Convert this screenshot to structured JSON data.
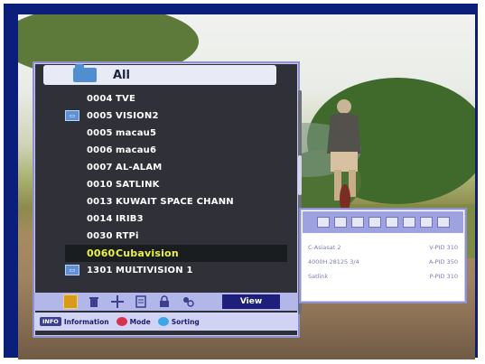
{
  "channel_list": {
    "group_name": "All",
    "channels": [
      {
        "number": "0004",
        "name": "TVE",
        "icon": ""
      },
      {
        "number": "0005",
        "name": "VISION2",
        "icon": "tv-channel-icon"
      },
      {
        "number": "0005",
        "name": "macau5",
        "icon": ""
      },
      {
        "number": "0006",
        "name": "macau6",
        "icon": ""
      },
      {
        "number": "0007",
        "name": "AL-ALAM",
        "icon": ""
      },
      {
        "number": "0010",
        "name": "SATLINK",
        "icon": ""
      },
      {
        "number": "0013",
        "name": "KUWAIT SPACE CHANN",
        "icon": ""
      },
      {
        "number": "0014",
        "name": "IRIB3",
        "icon": ""
      },
      {
        "number": "0030",
        "name": "RTPi",
        "icon": ""
      },
      {
        "number": "0060",
        "name": "Cubavision",
        "icon": "",
        "selected": true
      },
      {
        "number": "1301",
        "name": "MULTIVISION 1",
        "icon": "tv-channel-icon"
      }
    ]
  },
  "toolbar": {
    "icons": [
      "favorite-icon",
      "delete-icon",
      "move-icon",
      "edit-icon",
      "lock-icon",
      "skip-icon"
    ],
    "view_label": "View"
  },
  "legend": {
    "info_key": "INFO",
    "info_label": "Information",
    "red_label": "Mode",
    "blue_label": "Sorting",
    "red_color": "#d6324f",
    "blue_color": "#3da6e8"
  },
  "info_panel": {
    "satellite": "C-Asiasat 2",
    "transponder": "4000H 28125 3/4",
    "provider": "Satlink",
    "vpid": "V-PID 310",
    "apid": "A-PID 350",
    "ppid": "P-PID 310"
  },
  "colors": {
    "panel_border": "#8f90cf",
    "frame": "#0b1f7a",
    "selected_text": "#e9f24a"
  }
}
